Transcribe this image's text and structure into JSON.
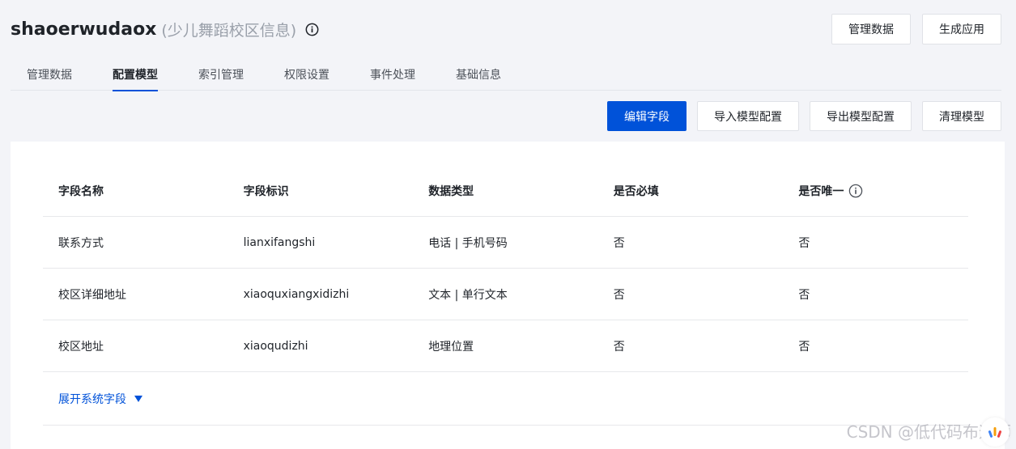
{
  "header": {
    "title": "shaoerwudaox",
    "subtitle": "(少儿舞蹈校区信息)",
    "actions": {
      "manage_data": "管理数据",
      "generate_app": "生成应用"
    }
  },
  "tabs": [
    {
      "label": "管理数据",
      "active": false
    },
    {
      "label": "配置模型",
      "active": true
    },
    {
      "label": "索引管理",
      "active": false
    },
    {
      "label": "权限设置",
      "active": false
    },
    {
      "label": "事件处理",
      "active": false
    },
    {
      "label": "基础信息",
      "active": false
    }
  ],
  "toolbar": {
    "edit_fields": "编辑字段",
    "import_config": "导入模型配置",
    "export_config": "导出模型配置",
    "clear_model": "清理模型"
  },
  "table": {
    "columns": [
      "字段名称",
      "字段标识",
      "数据类型",
      "是否必填",
      "是否唯一"
    ],
    "rows": [
      [
        "联系方式",
        "lianxifangshi",
        "电话 | 手机号码",
        "否",
        "否"
      ],
      [
        "校区详细地址",
        "xiaoquxiangxidizhi",
        "文本 | 单行文本",
        "否",
        "否"
      ],
      [
        "校区地址",
        "xiaoqudizhi",
        "地理位置",
        "否",
        "否"
      ]
    ]
  },
  "expand_system_fields": "展开系统字段",
  "watermark": "CSDN @低代码布道师",
  "colors": {
    "primary": "#0052d9",
    "background": "#f3f4f8",
    "border": "#e7e8eb"
  },
  "icons": {
    "title_info": "info-circle-icon",
    "unique_hint": "info-circle-icon",
    "expand": "caret-down-icon"
  }
}
